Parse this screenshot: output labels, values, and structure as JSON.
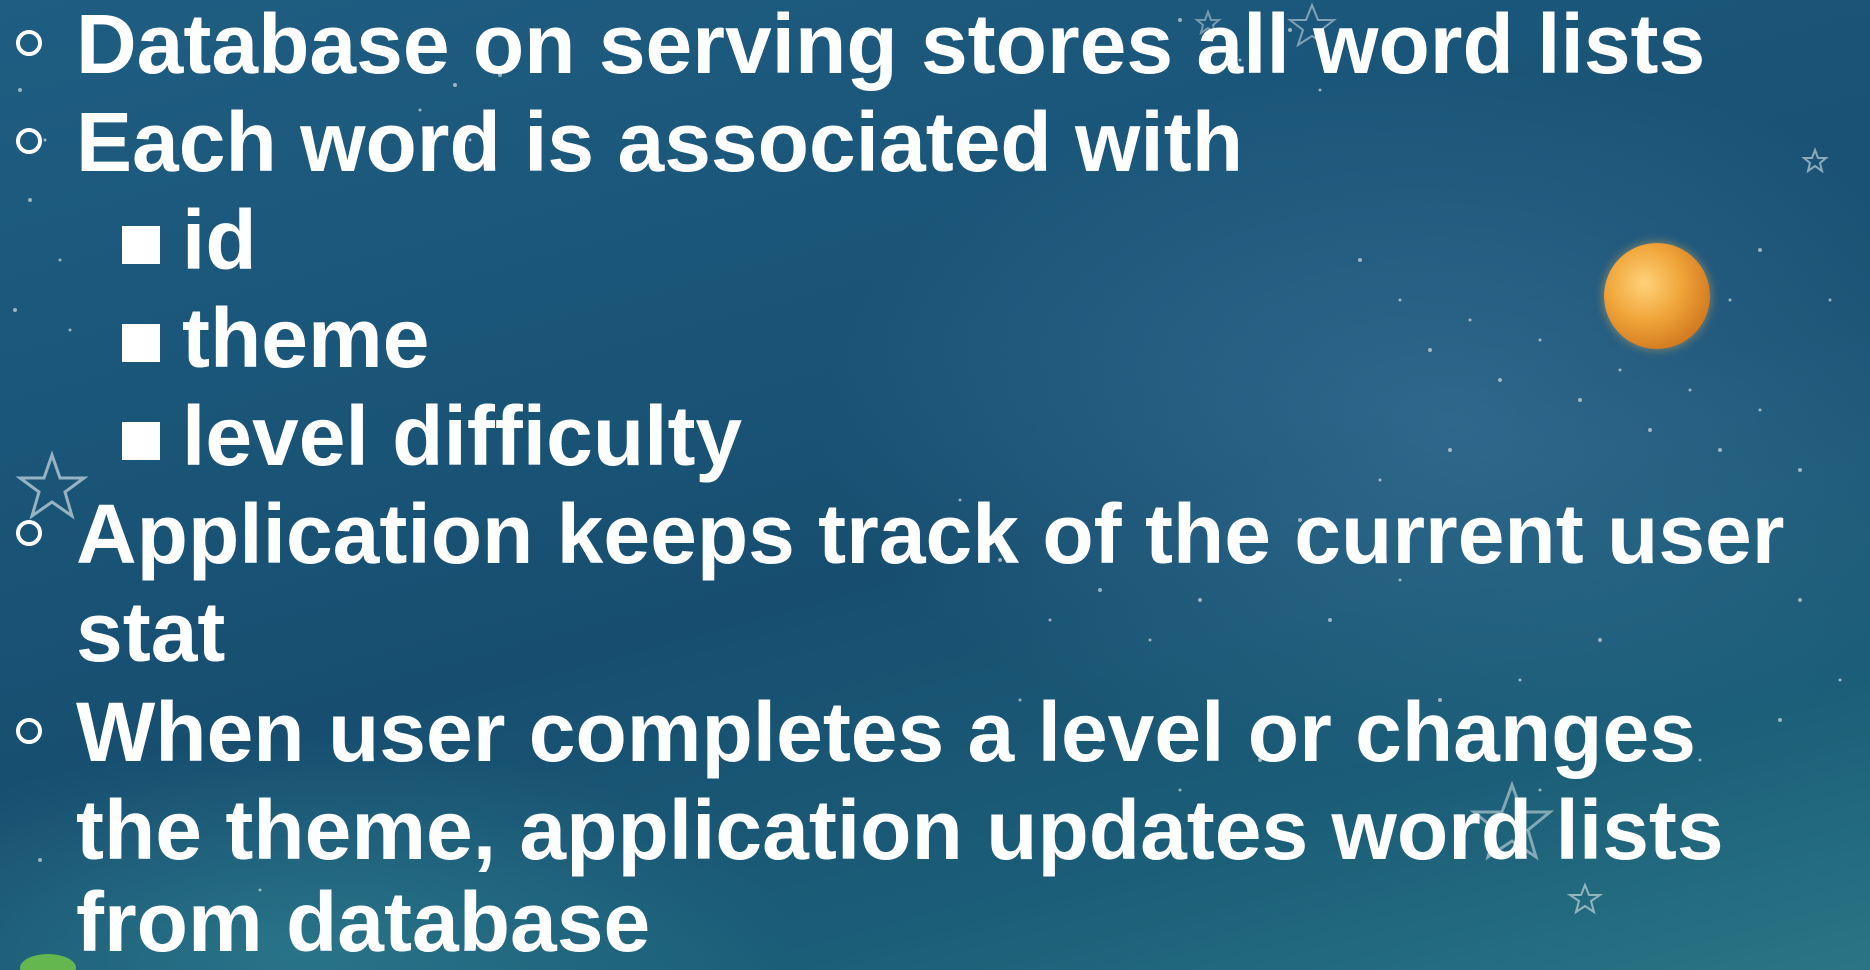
{
  "slide": {
    "bullets": [
      {
        "level": 1,
        "text": "Database on serving stores all word lists"
      },
      {
        "level": 1,
        "text": "Each word is associated with"
      },
      {
        "level": 2,
        "text": "id"
      },
      {
        "level": 2,
        "text": "theme"
      },
      {
        "level": 2,
        "text": "level difficulty"
      },
      {
        "level": 1,
        "text": "Application keeps track of the current user"
      },
      {
        "level": 1,
        "text": "stat",
        "continuation": true
      },
      {
        "level": 1,
        "text": "When user completes a level or changes"
      },
      {
        "level": 1,
        "text": "the theme, application updates word lists",
        "continuation": true
      },
      {
        "level": 1,
        "text": "from database",
        "continuation": true
      }
    ]
  },
  "decor": {
    "background_colors": [
      "#1f5d82",
      "#174e70",
      "#2a7585"
    ],
    "planet_color": "#f0a53a",
    "icons": [
      "star-icon",
      "planet-icon",
      "sparkle-field"
    ]
  }
}
